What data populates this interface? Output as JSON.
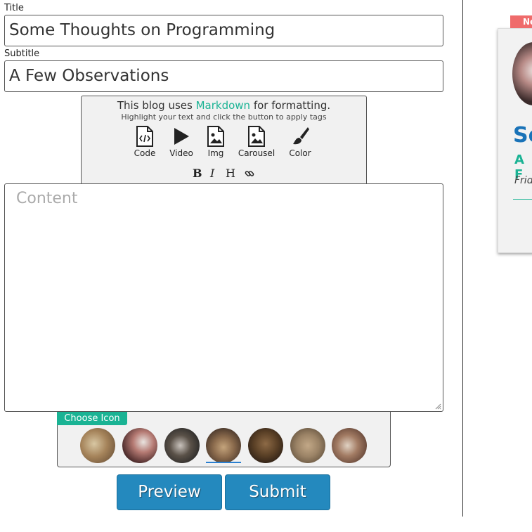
{
  "form": {
    "title_label": "Title",
    "title_value": "Some Thoughts on Programming",
    "subtitle_label": "Subtitle",
    "subtitle_value": "A Few Observations"
  },
  "toolbar": {
    "intro_prefix": "This blog uses ",
    "intro_link": "Markdown",
    "intro_suffix": " for formatting.",
    "hint": "Highlight your text and click the button to apply tags",
    "tools": {
      "code": "Code",
      "video": "Video",
      "img": "Img",
      "carousel": "Carousel",
      "color": "Color"
    },
    "format": {
      "bold": "B",
      "italic": "I",
      "heading": "H"
    }
  },
  "content": {
    "placeholder": "Content"
  },
  "icon_chooser": {
    "label": "Choose Icon",
    "selected_index": 3,
    "count": 7
  },
  "buttons": {
    "preview": "Preview",
    "submit": "Submit"
  },
  "preview_card": {
    "badge": "Ne",
    "title": "So",
    "subtitle": "A F",
    "date": "Frid"
  },
  "colors": {
    "accent": "#1ab394",
    "button": "#2489be",
    "title_blue": "#1a73b8",
    "badge": "#ef6b6b"
  }
}
